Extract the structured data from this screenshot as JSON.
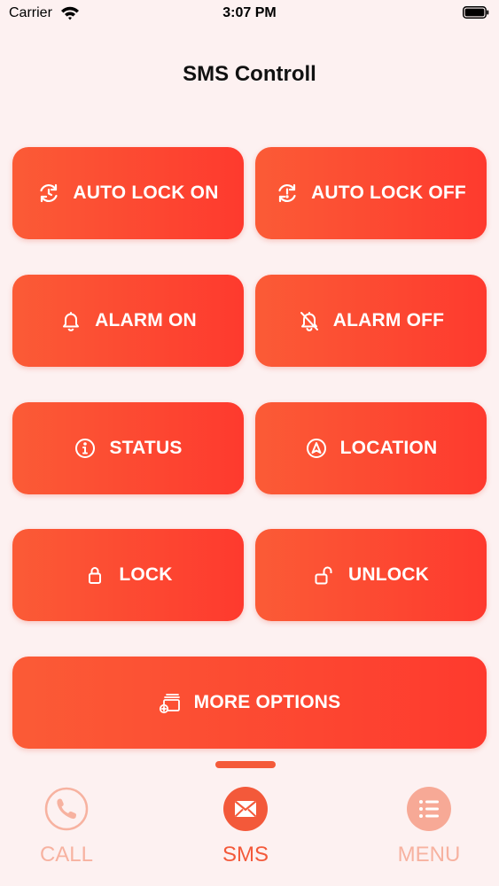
{
  "status_bar": {
    "carrier": "Carrier",
    "time": "3:07 PM"
  },
  "header": {
    "title": "SMS Controll"
  },
  "buttons": {
    "auto_lock_on": "AUTO LOCK ON",
    "auto_lock_off": "AUTO LOCK OFF",
    "alarm_on": "ALARM ON",
    "alarm_off": "ALARM OFF",
    "status": "STATUS",
    "location": "LOCATION",
    "lock": "LOCK",
    "unlock": "UNLOCK",
    "more_options": "MORE OPTIONS"
  },
  "tabs": [
    {
      "label": "CALL",
      "icon": "phone-icon",
      "active": false
    },
    {
      "label": "SMS",
      "icon": "envelope-icon",
      "active": true
    },
    {
      "label": "MENU",
      "icon": "list-icon",
      "active": false
    }
  ],
  "colors": {
    "accent": "#fb4e34",
    "inactive_tab": "#f7b2a0",
    "background": "#fdf1f1"
  }
}
